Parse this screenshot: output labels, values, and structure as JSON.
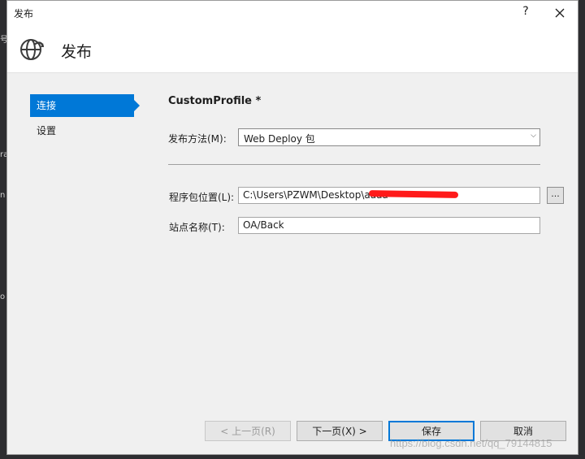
{
  "background": {
    "edge_glyphs": [
      "号",
      "ra",
      "n",
      "o"
    ]
  },
  "window": {
    "title": "发布",
    "help_label": "?",
    "close_icon": "close-icon"
  },
  "header": {
    "icon": "globe-icon",
    "title": "发布"
  },
  "nav": {
    "items": [
      {
        "label": "连接",
        "active": true
      },
      {
        "label": "设置",
        "active": false
      }
    ]
  },
  "main": {
    "profile_title": "CustomProfile *",
    "publish_method": {
      "label": "发布方法(M):",
      "value": "Web Deploy 包"
    },
    "package_location": {
      "label": "程序包位置(L):",
      "value": "C:\\Users\\PZWM\\Desktop\\aaaa",
      "browse_label": "..."
    },
    "site_name": {
      "label": "站点名称(T):",
      "value": "OA/Back"
    }
  },
  "footer": {
    "prev_label": "< 上一页(R)",
    "next_label": "下一页(X) >",
    "save_label": "保存",
    "cancel_label": "取消"
  },
  "watermark": "https://blog.csdn.net/qq_79144815",
  "colors": {
    "accent": "#0078d7",
    "redaction": "#ff1a1a"
  }
}
